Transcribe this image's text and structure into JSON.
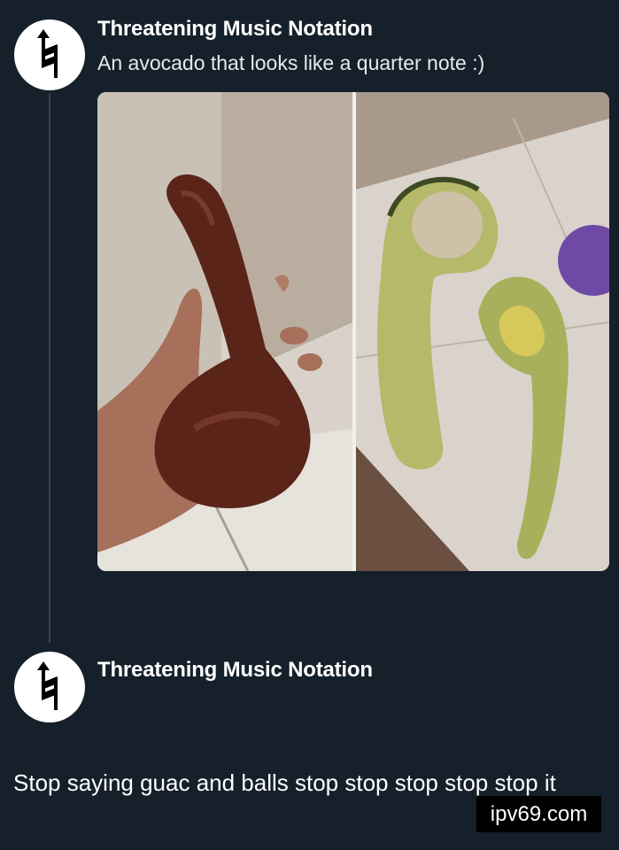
{
  "tweet": {
    "author": "Threatening Music Notation",
    "text": "An avocado that looks like a quarter note :)",
    "avatar_icon": "natural-sign-icon",
    "media_description_icon": "avocado-photo"
  },
  "reply": {
    "author": "Threatening Music Notation",
    "text": "Stop saying guac and balls stop stop stop stop stop it",
    "avatar_icon": "natural-sign-icon"
  },
  "watermark": {
    "text": "ipv69.com"
  },
  "colors": {
    "background": "#15202b",
    "thread_line": "#38444d",
    "text": "#ffffff"
  }
}
